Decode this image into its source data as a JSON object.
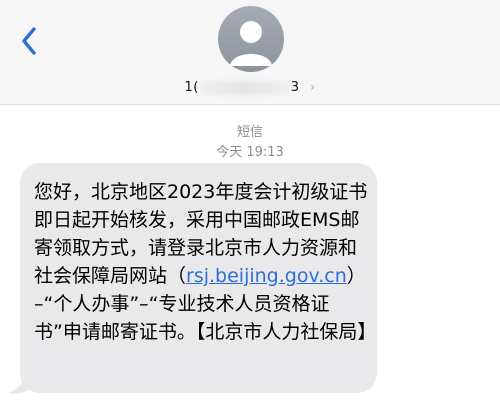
{
  "header": {
    "back_icon": "chevron-left-icon",
    "avatar_icon": "person-silhouette-icon",
    "contact_prefix": "1(",
    "contact_suffix": "3",
    "chevron": "›"
  },
  "conversation": {
    "message_type": "短信",
    "timestamp": "今天 19:13",
    "message": {
      "text_before_link": "您好，北京地区2023年度会计初级证书即日起开始核发，采用中国邮政EMS邮寄领取方式，请登录北京市人力资源和社会保障局网站（",
      "link": "rsj.beijing.gov.cn",
      "text_after_link": "）–“个人办事”–“专业技术人员资格证书”申请邮寄证书。【北京市人力社保局】"
    }
  },
  "colors": {
    "accent": "#2d6fd6",
    "bubble": "#e9e9eb",
    "header_bg": "#f6f6f7",
    "meta_text": "#8e8e93"
  }
}
